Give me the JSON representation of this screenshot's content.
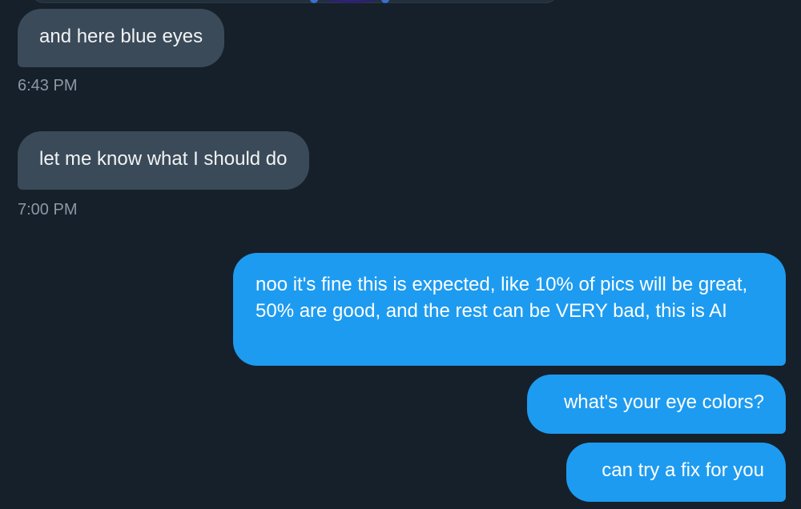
{
  "conversation": {
    "messages": [
      {
        "direction": "incoming",
        "text": "and here blue eyes",
        "timestamp": "6:43 PM"
      },
      {
        "direction": "incoming",
        "text": "let me know what I should do",
        "timestamp": "7:00 PM"
      },
      {
        "direction": "outgoing",
        "text": "noo it's fine this is expected, like 10% of pics will be great, 50% are good, and the rest can be VERY bad, this is AI"
      },
      {
        "direction": "outgoing",
        "text": "what's your eye colors?"
      },
      {
        "direction": "outgoing",
        "text": "can try a fix for you"
      }
    ]
  },
  "colors": {
    "background": "#16202a",
    "incoming_bubble": "#3a4a59",
    "outgoing_bubble": "#1d9bf0",
    "timestamp_text": "#8b98a5"
  }
}
